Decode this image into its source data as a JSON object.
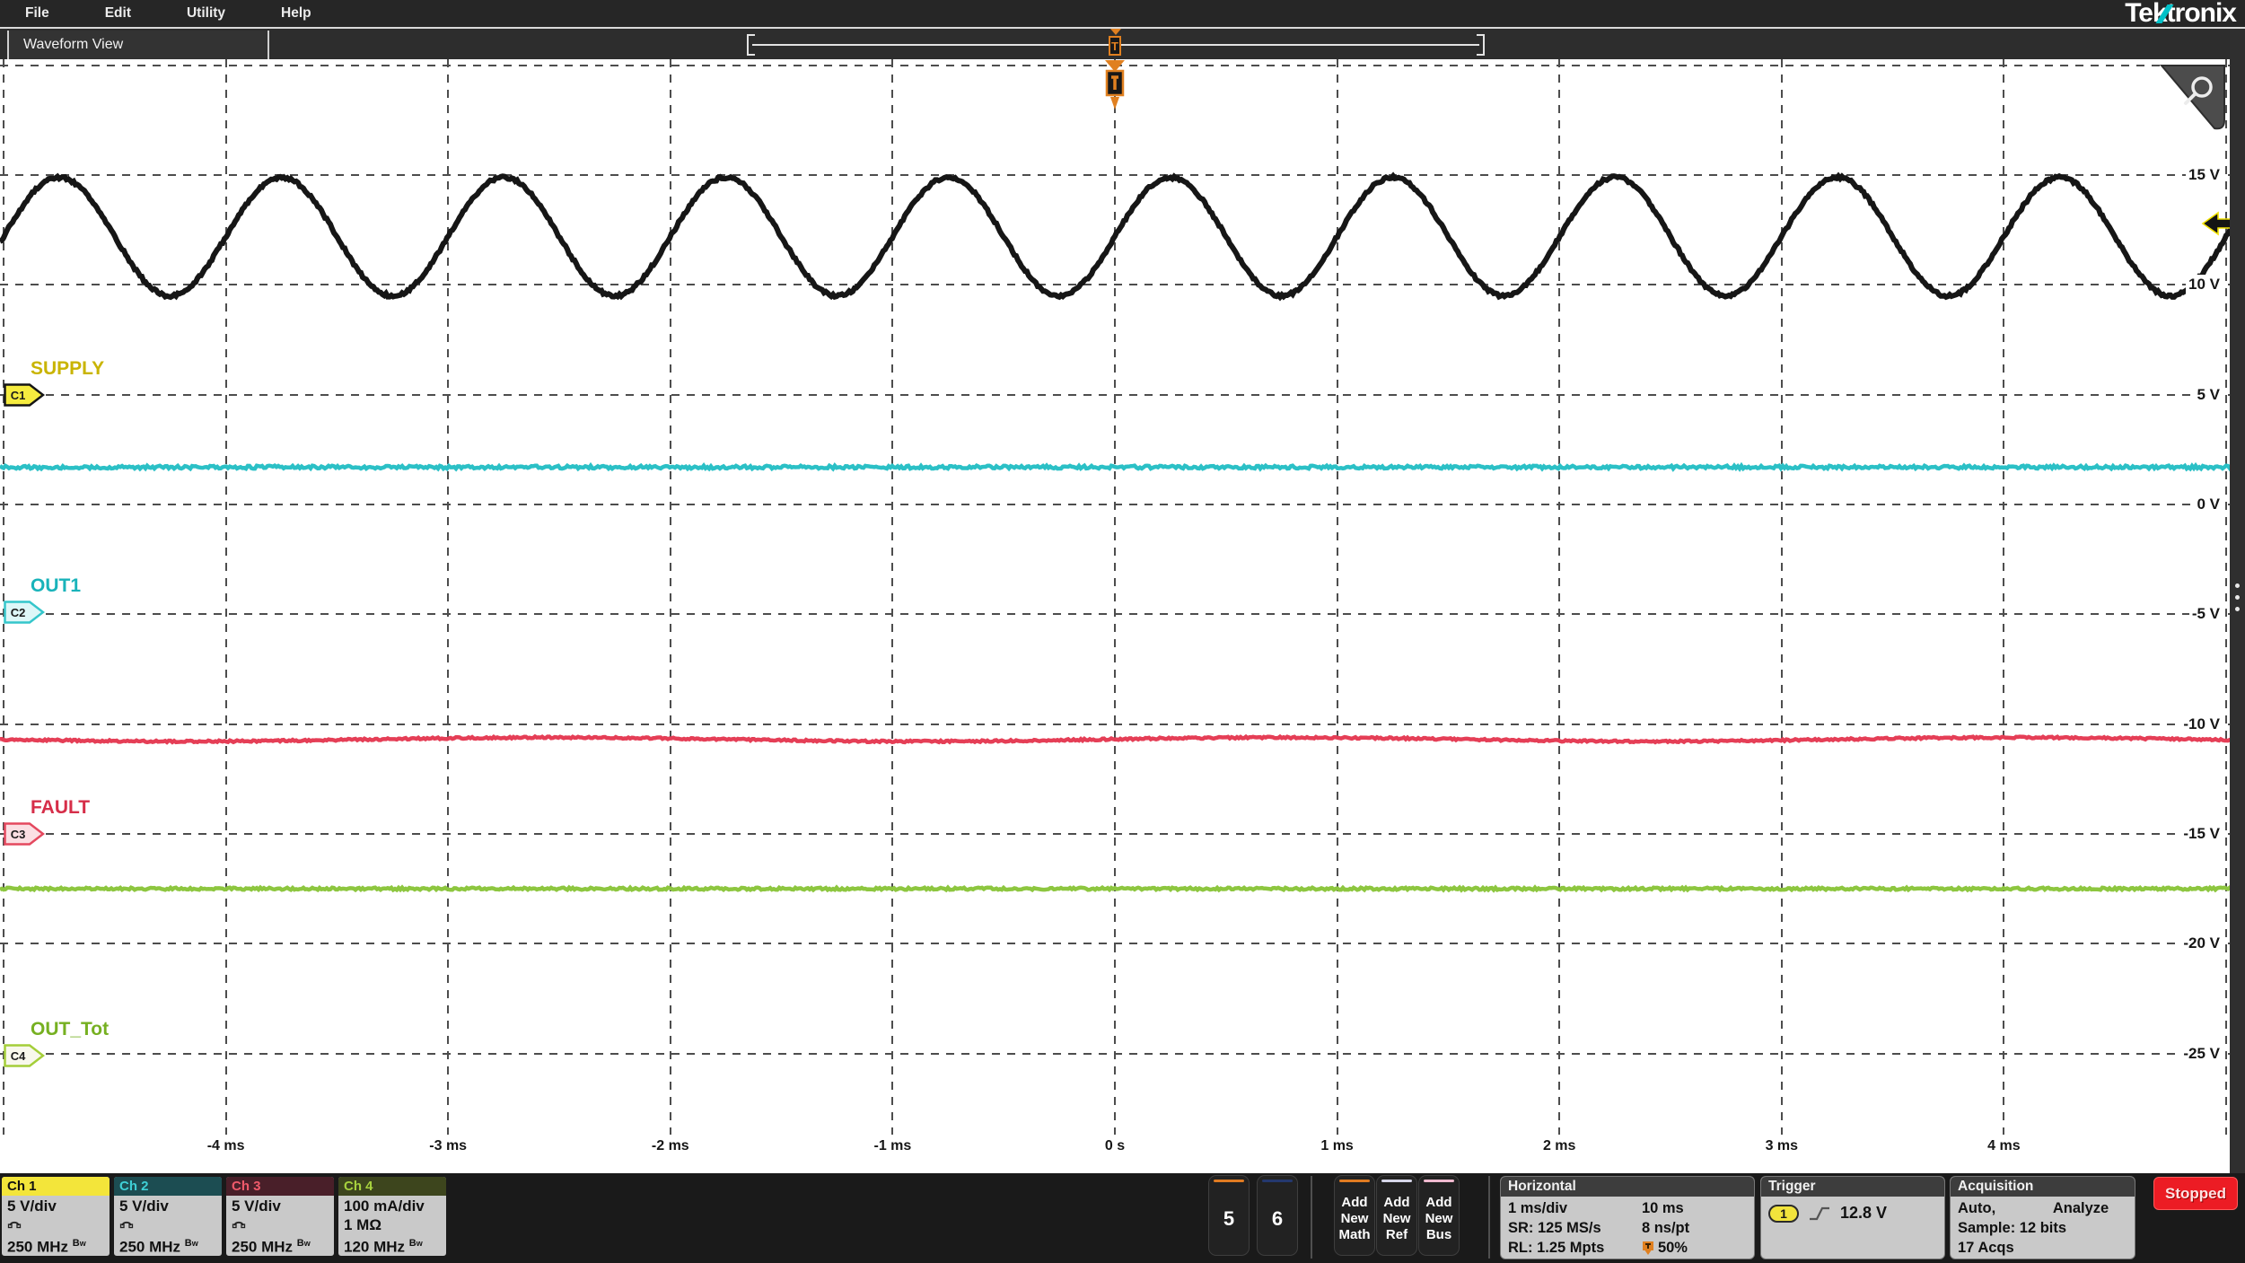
{
  "menu": {
    "items": [
      "File",
      "Edit",
      "Utility",
      "Help"
    ]
  },
  "logo": {
    "text": "Tektronix",
    "accent_color": "#00c1c8"
  },
  "tab": {
    "label": "Waveform View"
  },
  "trigger_marker": {
    "symbol": "T",
    "color": "#e08020",
    "position_pct": 50
  },
  "plot": {
    "voltage_labels": [
      {
        "text": "15 V",
        "v": 15
      },
      {
        "text": "10 V",
        "v": 10
      },
      {
        "text": "5 V",
        "v": 5
      },
      {
        "text": "0 V",
        "v": 0
      },
      {
        "text": "-5 V",
        "v": -5
      },
      {
        "text": "-10 V",
        "v": -10
      },
      {
        "text": "-15 V",
        "v": -15
      },
      {
        "text": "-20 V",
        "v": -20
      },
      {
        "text": "-25 V",
        "v": -25
      }
    ],
    "time_labels": [
      {
        "text": "-4 ms",
        "ms": -4
      },
      {
        "text": "-3 ms",
        "ms": -3
      },
      {
        "text": "-2 ms",
        "ms": -2
      },
      {
        "text": "-1 ms",
        "ms": -1
      },
      {
        "text": "0 s",
        "ms": 0
      },
      {
        "text": "1 ms",
        "ms": 1
      },
      {
        "text": "2 ms",
        "ms": 2
      },
      {
        "text": "3 ms",
        "ms": 3
      },
      {
        "text": "4 ms",
        "ms": 4
      }
    ],
    "grid": {
      "volts_per_div": 5,
      "ms_per_div": 1,
      "h_lines_v": [
        20,
        15,
        10,
        5,
        0,
        -5,
        -10,
        -15,
        -20,
        -25
      ],
      "v_lines_ms": [
        -5,
        -4,
        -3,
        -2,
        -1,
        0,
        1,
        2,
        3,
        4,
        5
      ]
    }
  },
  "channels": [
    {
      "id": "C1",
      "name": "Ch 1",
      "label": "SUPPLY",
      "position_v": 5.0,
      "badge_fill": "#f6ec3f",
      "badge_border": "#151515",
      "label_color": "#c9b400",
      "header_bg": "#f3e53a",
      "header_fg": "#111111",
      "rows": [
        {
          "text": "5 V/div"
        },
        {
          "icon": "probe-icon"
        },
        {
          "text": "250 MHz",
          "bw": true
        }
      ]
    },
    {
      "id": "C2",
      "name": "Ch 2",
      "label": "OUT1",
      "position_v": -4.9,
      "badge_fill": "#def7f8",
      "badge_border": "#35c6cb",
      "label_color": "#19b3ba",
      "header_bg": "#1c4d52",
      "header_fg": "#3fd0d6",
      "rows": [
        {
          "text": "5 V/div"
        },
        {
          "icon": "probe-icon"
        },
        {
          "text": "250 MHz",
          "bw": true
        }
      ]
    },
    {
      "id": "C3",
      "name": "Ch 3",
      "label": "FAULT",
      "position_v": -15.0,
      "badge_fill": "#fbdfe3",
      "badge_border": "#e4485e",
      "label_color": "#d62e49",
      "header_bg": "#491f29",
      "header_fg": "#f05a6b",
      "rows": [
        {
          "text": "5 V/div"
        },
        {
          "icon": "probe-icon"
        },
        {
          "text": "250 MHz",
          "bw": true
        }
      ]
    },
    {
      "id": "C4",
      "name": "Ch 4",
      "label": "OUT_Tot",
      "position_v": -25.1,
      "badge_fill": "#f8f8ec",
      "badge_border": "#a4ce39",
      "label_color": "#76b021",
      "header_bg": "#3d451d",
      "header_fg": "#a7d23e",
      "rows": [
        {
          "text": "100 mA/div"
        },
        {
          "text": "1 MΩ"
        },
        {
          "text": "120 MHz",
          "bw": true
        }
      ]
    }
  ],
  "chart_data": {
    "type": "line",
    "title": "Waveform View",
    "x_unit": "ms",
    "x_range": [
      -5,
      5
    ],
    "x_ticks": [
      "-4 ms",
      "-3 ms",
      "-2 ms",
      "-1 ms",
      "0 s",
      "1 ms",
      "2 ms",
      "3 ms",
      "4 ms"
    ],
    "y_unit": "V",
    "y_range": [
      -27.5,
      22.5
    ],
    "y_ticks": [
      "15 V",
      "10 V",
      "5 V",
      "0 V",
      "-5 V",
      "-10 V",
      "-15 V",
      "-20 V",
      "-25 V"
    ],
    "grid": "dashed",
    "series": [
      {
        "name": "SUPPLY (Ch 1)",
        "waveform": "sine",
        "frequency_hz": 1000,
        "period_ms": 1,
        "mean_v": 12.2,
        "amplitude_v": 2.7,
        "color": "#161616"
      },
      {
        "name": "OUT1 (Ch 2)",
        "waveform": "dc",
        "level_v": 1.7,
        "color": "#2bc0c6"
      },
      {
        "name": "FAULT (Ch 3)",
        "waveform": "dc",
        "level_v": -10.7,
        "color": "#e53e56"
      },
      {
        "name": "OUT_Tot (Ch 4)",
        "waveform": "dc",
        "level_v": -17.5,
        "color": "#8dc63f"
      }
    ],
    "trigger": {
      "source": "Ch 1",
      "level_v": 12.8,
      "position_pct": 50
    }
  },
  "scope_buttons": [
    {
      "label": "5",
      "stripe": "#e07b22"
    },
    {
      "label": "6",
      "stripe": "#24386e"
    }
  ],
  "add_buttons": [
    {
      "label": "Add New Math",
      "stripe": "#e07b22"
    },
    {
      "label": "Add New Ref",
      "stripe": "#d6d6e8"
    },
    {
      "label": "Add New Bus",
      "stripe": "#efb9ce"
    }
  ],
  "horizontal": {
    "title": "Horizontal",
    "rows": [
      {
        "left": "1 ms/div",
        "right": "10 ms"
      },
      {
        "left": "SR: 125 MS/s",
        "right": "8 ns/pt"
      },
      {
        "left": "RL: 1.25 Mpts",
        "right": "50%",
        "right_icon": "trigger-t-icon"
      }
    ]
  },
  "trigger": {
    "title": "Trigger",
    "source": "1",
    "slope": "rising",
    "level": "12.8 V"
  },
  "acquisition": {
    "title": "Acquisition",
    "rows": [
      {
        "left": "Auto,",
        "right": "Analyze"
      },
      {
        "left": "Sample: 12 bits",
        "right": ""
      },
      {
        "left": "17 Acqs",
        "right": ""
      }
    ],
    "status": "Stopped"
  }
}
